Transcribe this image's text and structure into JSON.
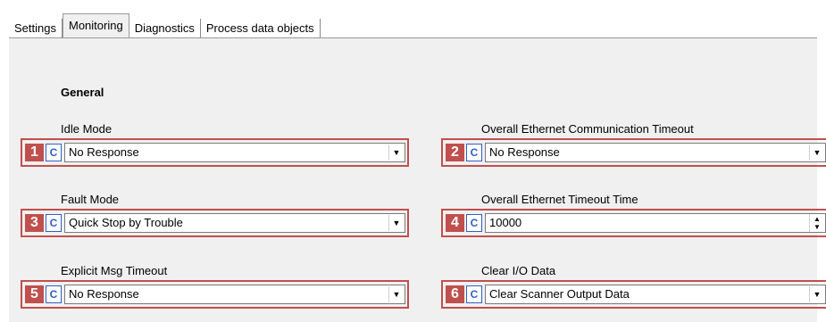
{
  "tabs": [
    {
      "label": "Settings"
    },
    {
      "label": "Monitoring"
    },
    {
      "label": "Diagnostics"
    },
    {
      "label": "Process data objects"
    }
  ],
  "section": {
    "title": "General"
  },
  "fields": {
    "idle_mode": {
      "number": "1",
      "badge": "C",
      "label": "Idle Mode",
      "value": "No Response"
    },
    "comm_timeout": {
      "number": "2",
      "badge": "C",
      "label": "Overall Ethernet Communication Timeout",
      "value": "No Response"
    },
    "fault_mode": {
      "number": "3",
      "badge": "C",
      "label": "Fault Mode",
      "value": "Quick Stop by Trouble"
    },
    "timeout_time": {
      "number": "4",
      "badge": "C",
      "label": "Overall Ethernet Timeout Time",
      "value": "10000"
    },
    "explicit_timeout": {
      "number": "5",
      "badge": "C",
      "label": "Explicit Msg Timeout",
      "value": "No Response"
    },
    "clear_io": {
      "number": "6",
      "badge": "C",
      "label": "Clear I/O Data",
      "value": "Clear Scanner Output Data"
    }
  },
  "icons": {
    "dropdown": "chevron-down-icon",
    "spinner": "spinner-arrows-icon"
  },
  "colors": {
    "highlight": "#c0504d",
    "badge_blue": "#2f5fc4",
    "panel": "#f0f0f0"
  }
}
